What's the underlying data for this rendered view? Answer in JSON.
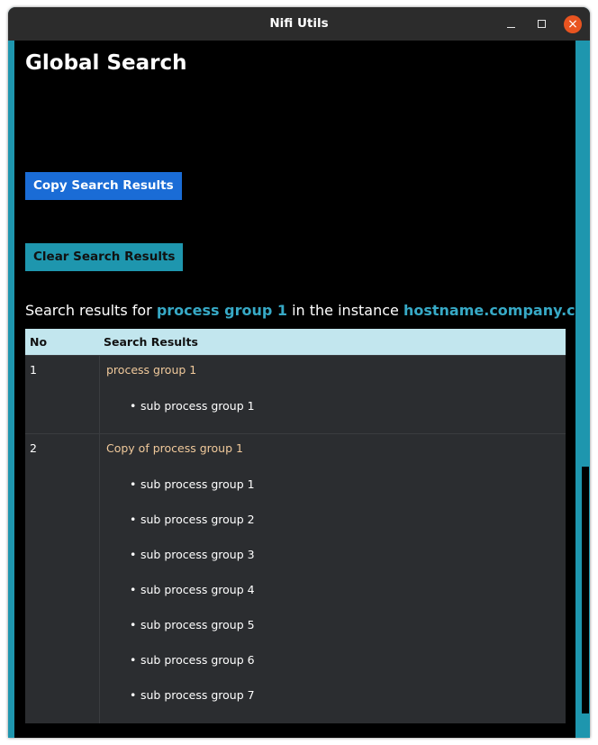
{
  "window": {
    "title": "Nifi Utils"
  },
  "page": {
    "heading": "Global Search",
    "copy_button": "Copy Search Results",
    "clear_button": "Clear Search Results",
    "results_prefix": "Search results for ",
    "query": "process group 1",
    "results_middle": " in the instance ",
    "instance": "hostname.company.com",
    "results_suffix": " :"
  },
  "table": {
    "headers": [
      "No",
      "Search Results"
    ],
    "rows": [
      {
        "no": "1",
        "group": "process group 1",
        "children": [
          "sub process group 1"
        ]
      },
      {
        "no": "2",
        "group": "Copy of process group 1",
        "children": [
          "sub process group 1",
          "sub process group 2",
          "sub process group 3",
          "sub process group 4",
          "sub process group 5",
          "sub process group 6",
          "sub process group 7"
        ]
      }
    ]
  },
  "colors": {
    "accent": "#1e96ae",
    "primary_button": "#1a6cd6",
    "highlight_text": "#37a9c6",
    "group_text": "#f0c99b",
    "table_header_bg": "#c2e6ee",
    "row_bg": "#2b2d30",
    "close_button": "#e95420"
  },
  "icons": {
    "minimize": "minimize-icon",
    "maximize": "maximize-icon",
    "close": "close-icon"
  }
}
